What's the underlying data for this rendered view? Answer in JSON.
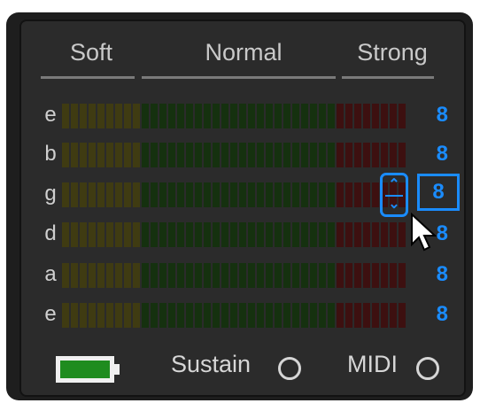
{
  "headers": [
    "Soft",
    "Normal",
    "Strong"
  ],
  "rows": [
    {
      "string": "e",
      "value": "8"
    },
    {
      "string": "b",
      "value": "8"
    },
    {
      "string": "g",
      "value": "8"
    },
    {
      "string": "d",
      "value": "8"
    },
    {
      "string": "a",
      "value": "8"
    },
    {
      "string": "e",
      "value": "8"
    }
  ],
  "editing": {
    "row_index": 2,
    "value": "8"
  },
  "footer": {
    "sustain_label": "Sustain",
    "midi_label": "MIDI"
  },
  "colors": {
    "soft": "#3f3b12",
    "normal": "#15310f",
    "strong": "#3d1010",
    "accent": "#1a8cff",
    "battery": "#1f8c1f"
  },
  "icons": [
    "battery-icon",
    "stepper-up-icon",
    "stepper-down-icon",
    "mouse-cursor-icon"
  ]
}
